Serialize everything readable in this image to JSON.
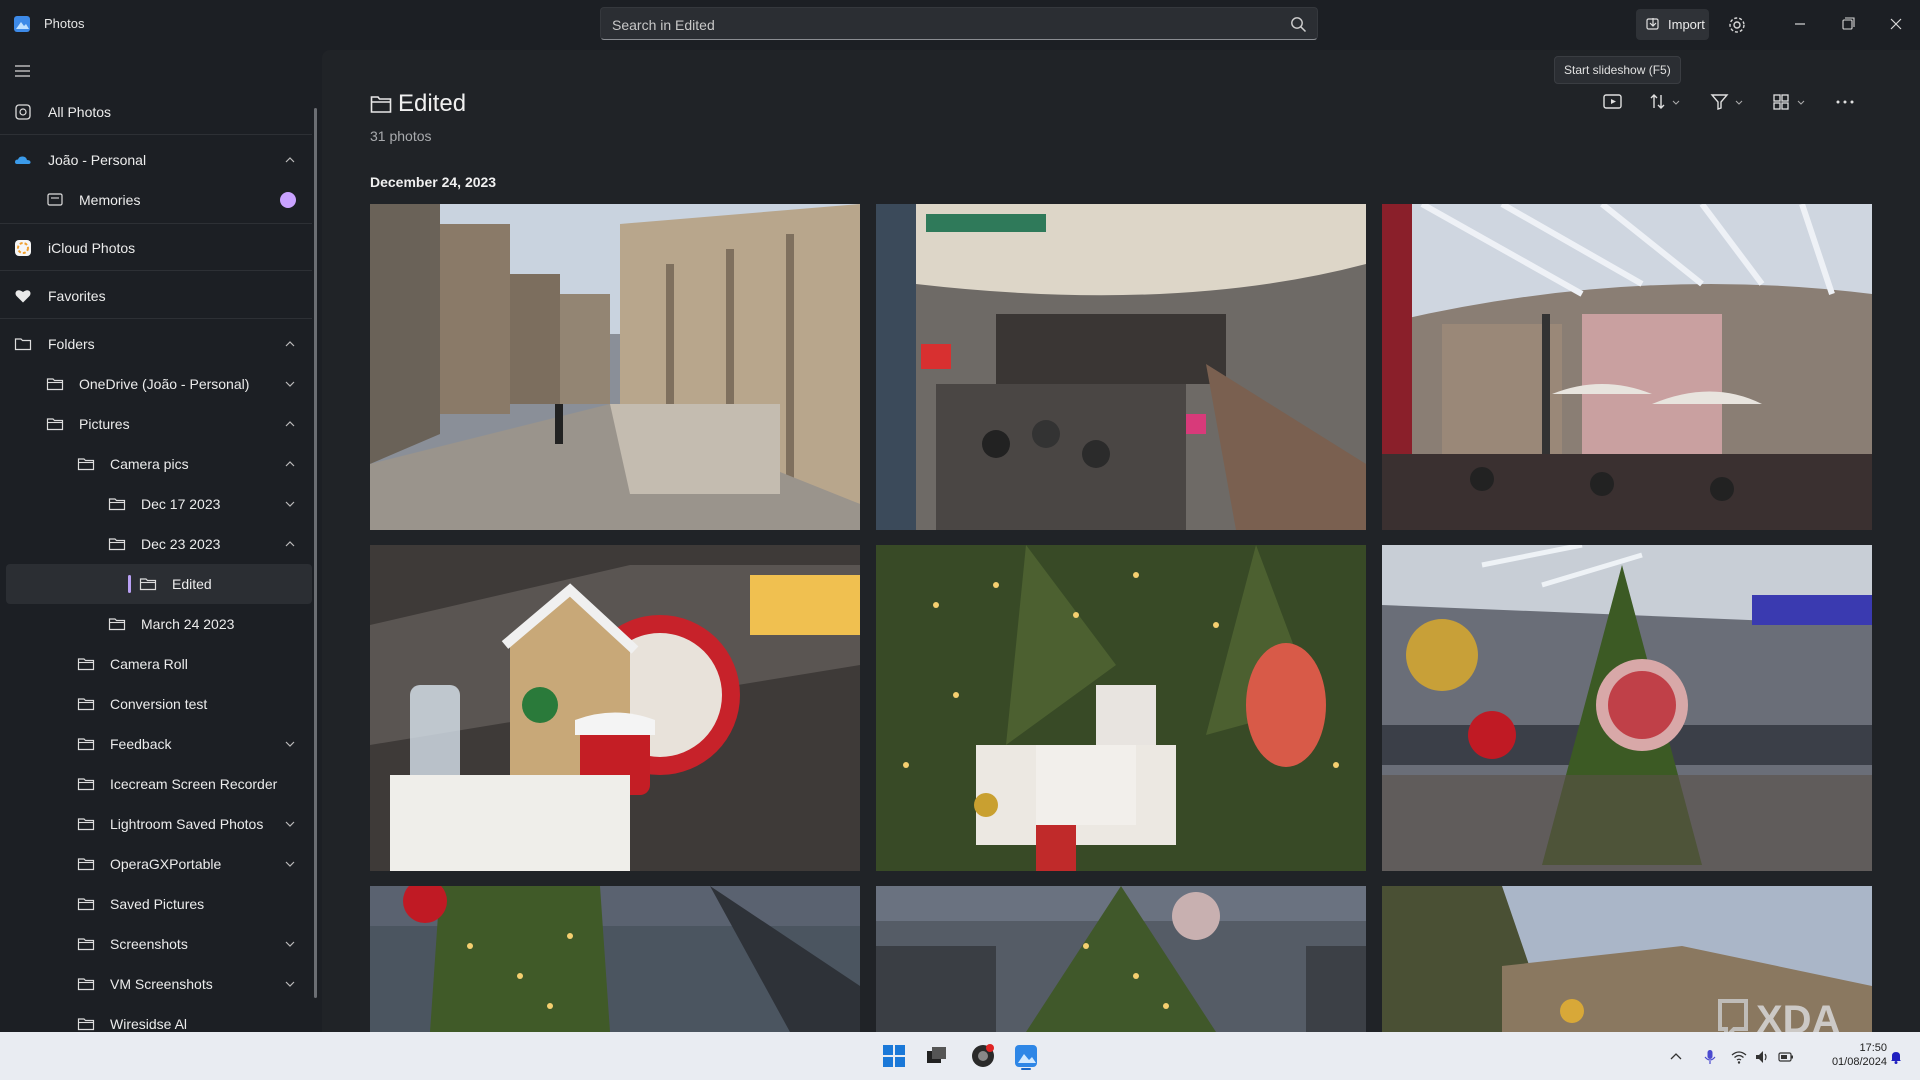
{
  "app": {
    "title": "Photos"
  },
  "search": {
    "placeholder": "Search in Edited"
  },
  "titlebar": {
    "import_label": "Import"
  },
  "sidebar": {
    "all_photos": "All Photos",
    "account": "João - Personal",
    "memories": "Memories",
    "icloud": "iCloud Photos",
    "favorites": "Favorites",
    "folders": "Folders",
    "tree": [
      "OneDrive (João - Personal)",
      "Pictures",
      "Camera pics",
      "Dec 17 2023",
      "Dec 23 2023",
      "Edited",
      "March 24 2023",
      "Camera Roll",
      "Conversion test",
      "Feedback",
      "Icecream Screen Recorder",
      "Lightroom Saved Photos",
      "OperaGXPortable",
      "Saved Pictures",
      "Screenshots",
      "VM Screenshots",
      "Wiresidse Al"
    ]
  },
  "main": {
    "title": "Edited",
    "count": "31 photos",
    "date_group": "December 24, 2023",
    "tooltip": "Start slideshow (F5)"
  },
  "photos": [
    {
      "id": "photo-1",
      "kind": "street"
    },
    {
      "id": "photo-2",
      "kind": "mall-interior"
    },
    {
      "id": "photo-3",
      "kind": "mall-village"
    },
    {
      "id": "photo-4",
      "kind": "gingerbread-house"
    },
    {
      "id": "photo-5",
      "kind": "christmas-sleigh"
    },
    {
      "id": "photo-6",
      "kind": "christmas-baubles"
    },
    {
      "id": "photo-7",
      "kind": "christmas-tree"
    },
    {
      "id": "photo-8",
      "kind": "christmas-tree-mall"
    },
    {
      "id": "photo-9",
      "kind": "building-dusk"
    }
  ],
  "taskbar": {
    "time": "17:50",
    "date": "01/08/2024"
  },
  "watermark": {
    "text": "XDA"
  },
  "colors": {
    "accent": "#b9a0f4",
    "background": "#1c1f24",
    "panel": "#202327",
    "taskbar": "#e9ecf2"
  }
}
